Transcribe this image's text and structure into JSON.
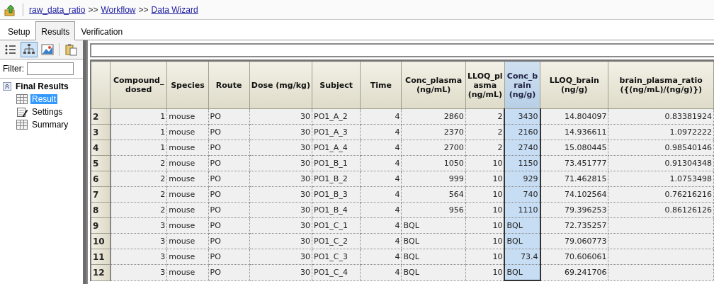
{
  "breadcrumb": [
    "raw_data_ratio",
    "Workflow",
    "Data Wizard"
  ],
  "breadcrumb_separator": ">>",
  "tabs": [
    {
      "label": "Setup",
      "selected": false
    },
    {
      "label": "Results",
      "selected": true
    },
    {
      "label": "Verification",
      "selected": false
    }
  ],
  "toolbar": [
    {
      "kind": "list",
      "selected": false
    },
    {
      "kind": "tree",
      "selected": true
    },
    {
      "kind": "chart",
      "selected": false
    },
    {
      "kind": "clipboard",
      "selected": false
    }
  ],
  "filter": {
    "label": "Filter:"
  },
  "tree": [
    {
      "label": "Final Results",
      "expanded": true,
      "children": [
        {
          "label": "Result",
          "kind": "table",
          "selected": true
        },
        {
          "label": "Settings",
          "kind": "settings",
          "selected": false
        },
        {
          "label": "Summary",
          "kind": "table",
          "selected": false
        }
      ]
    }
  ],
  "grid": {
    "columns": [
      {
        "label": "Compound_dosed",
        "selected": false
      },
      {
        "label": "Species",
        "selected": false
      },
      {
        "label": "Route",
        "selected": false
      },
      {
        "label": "Dose (mg/kg)",
        "selected": false
      },
      {
        "label": "Subject",
        "selected": false
      },
      {
        "label": "Time",
        "selected": false
      },
      {
        "label": "Conc_plasma (ng/mL)",
        "selected": false
      },
      {
        "label": "LLOQ_plasma (ng/mL)",
        "selected": false
      },
      {
        "label": "Conc_brain (ng/g)",
        "selected": true
      },
      {
        "label": "LLOQ_brain (ng/g)",
        "selected": false
      },
      {
        "label": "brain_plasma_ratio ({(ng/mL)/(ng/g)})",
        "selected": false
      }
    ],
    "rows": [
      {
        "number": "2",
        "cells": [
          "1",
          "mouse",
          "PO",
          "30",
          "PO1_A_2",
          "4",
          "2860",
          "2",
          "3430",
          "14.804097",
          "0.83381924"
        ]
      },
      {
        "number": "3",
        "cells": [
          "1",
          "mouse",
          "PO",
          "30",
          "PO1_A_3",
          "4",
          "2370",
          "2",
          "2160",
          "14.936611",
          "1.0972222"
        ]
      },
      {
        "number": "4",
        "cells": [
          "1",
          "mouse",
          "PO",
          "30",
          "PO1_A_4",
          "4",
          "2700",
          "2",
          "2740",
          "15.080445",
          "0.98540146"
        ]
      },
      {
        "number": "5",
        "cells": [
          "2",
          "mouse",
          "PO",
          "30",
          "PO1_B_1",
          "4",
          "1050",
          "10",
          "1150",
          "73.451777",
          "0.91304348"
        ]
      },
      {
        "number": "6",
        "cells": [
          "2",
          "mouse",
          "PO",
          "30",
          "PO1_B_2",
          "4",
          "999",
          "10",
          "929",
          "71.462815",
          "1.0753498"
        ]
      },
      {
        "number": "7",
        "cells": [
          "2",
          "mouse",
          "PO",
          "30",
          "PO1_B_3",
          "4",
          "564",
          "10",
          "740",
          "74.102564",
          "0.76216216"
        ]
      },
      {
        "number": "8",
        "cells": [
          "2",
          "mouse",
          "PO",
          "30",
          "PO1_B_4",
          "4",
          "956",
          "10",
          "1110",
          "79.396253",
          "0.86126126"
        ]
      },
      {
        "number": "9",
        "cells": [
          "3",
          "mouse",
          "PO",
          "30",
          "PO1_C_1",
          "4",
          "BQL",
          "10",
          "BQL",
          "72.735257",
          ""
        ]
      },
      {
        "number": "10",
        "cells": [
          "3",
          "mouse",
          "PO",
          "30",
          "PO1_C_2",
          "4",
          "BQL",
          "10",
          "BQL",
          "79.060773",
          ""
        ]
      },
      {
        "number": "11",
        "cells": [
          "3",
          "mouse",
          "PO",
          "30",
          "PO1_C_3",
          "4",
          "BQL",
          "10",
          "73.4",
          "70.606061",
          ""
        ]
      },
      {
        "number": "12",
        "cells": [
          "3",
          "mouse",
          "PO",
          "30",
          "PO1_C_4",
          "4",
          "BQL",
          "10",
          "BQL",
          "69.241706",
          ""
        ]
      }
    ]
  }
}
